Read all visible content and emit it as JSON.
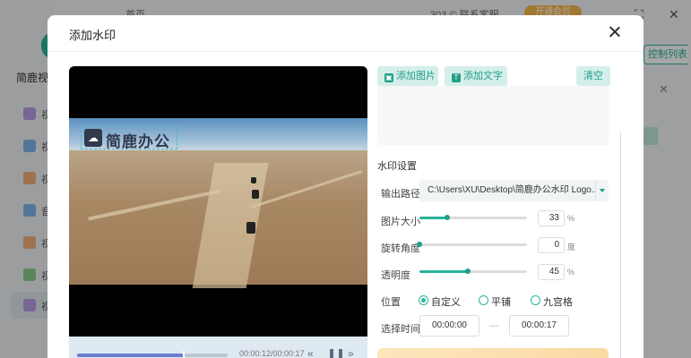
{
  "background": {
    "brand": "简鹿视频",
    "top_left": "首页",
    "top_right": "303 © 联系客服",
    "badge": "开通会员",
    "nav_items": [
      "视",
      "视",
      "视",
      "音",
      "视",
      "视",
      "视"
    ],
    "list_button": "控制列表"
  },
  "modal": {
    "title": "添加水印",
    "close_icon": "close-icon"
  },
  "preview": {
    "watermark_text": "简鹿办公",
    "time_label": "00:00:12/00:00:17",
    "progress": 0.7
  },
  "toolbar": {
    "add_image": "添加图片",
    "add_text": "添加文字",
    "clear": "清空"
  },
  "settings": {
    "section_title": "水印设置",
    "output_path_label": "输出路径",
    "output_path_value": "C:\\Users\\XU\\Desktop\\简鹿办公水印 Logo...",
    "image_size": {
      "label": "图片大小",
      "value": "33",
      "unit": "%",
      "level": 0.26
    },
    "rotation": {
      "label": "旋转角度",
      "value": "0",
      "unit": "度",
      "level": 0.0
    },
    "opacity": {
      "label": "透明度",
      "value": "45",
      "unit": "%",
      "level": 0.45
    },
    "position": {
      "label": "位置",
      "options": [
        "自定义",
        "平铺",
        "九宫格"
      ],
      "selected": "自定义"
    },
    "time": {
      "label": "选择时间",
      "start": "00:00:00",
      "dash": "—",
      "end": "00:00:17"
    }
  },
  "colors": {
    "accent": "#29b39a",
    "accent_light": "#d4eee9"
  }
}
